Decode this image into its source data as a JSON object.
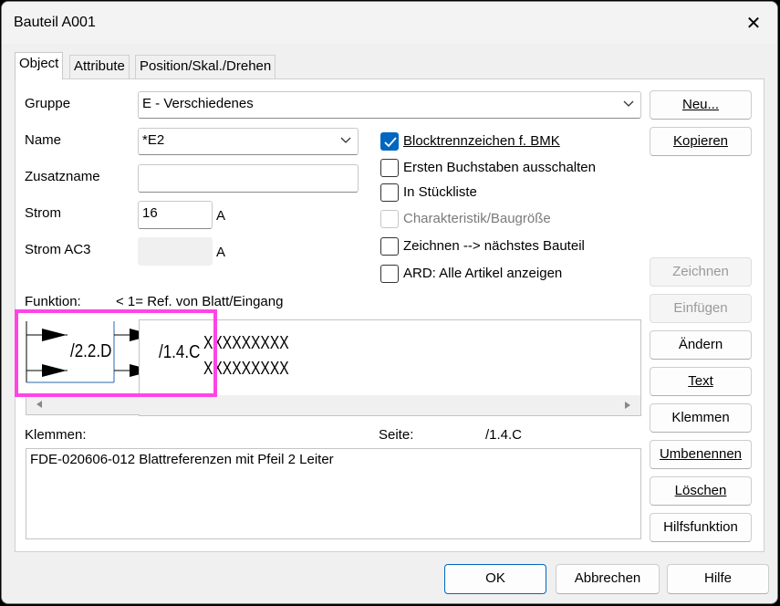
{
  "window": {
    "title": "Bauteil A001"
  },
  "tabs": [
    {
      "label": "Object",
      "active": true
    },
    {
      "label": "Attribute",
      "active": false
    },
    {
      "label": "Position/Skal./Drehen",
      "active": false
    }
  ],
  "form": {
    "gruppe_label": "Gruppe",
    "gruppe_value": "E - Verschiedenes",
    "name_label": "Name",
    "name_value": "*E2",
    "zusatzname_label": "Zusatzname",
    "zusatzname_value": "",
    "strom_label": "Strom",
    "strom_value": "16",
    "strom_unit": "A",
    "strom_ac3_label": "Strom AC3",
    "strom_ac3_value": "",
    "strom_ac3_unit": "A"
  },
  "checkboxes": [
    {
      "label": "Blocktrennzeichen f. BMK",
      "checked": true,
      "enabled": true
    },
    {
      "label": "Ersten Buchstaben ausschalten",
      "checked": false,
      "enabled": true
    },
    {
      "label": "In Stückliste",
      "checked": false,
      "enabled": true
    },
    {
      "label": "Charakteristik/Baugröße",
      "checked": false,
      "enabled": false
    },
    {
      "label": "Zeichnen --> nächstes Bauteil",
      "checked": false,
      "enabled": true
    },
    {
      "label": "ARD: Alle Artikel anzeigen",
      "checked": false,
      "enabled": true
    }
  ],
  "funktion": {
    "label": "Funktion:",
    "value": "< 1= Ref. von Blatt/Eingang",
    "ref_left": "/2.2.D",
    "ref_right": "/1.4.C",
    "text_line1": "XXXXXXXXX",
    "text_line2": "XXXXXXXXX"
  },
  "klemmen": {
    "label": "Klemmen:",
    "seite_label": "Seite:",
    "seite_value": "/1.4.C",
    "content": "FDE-020606-012  Blattreferenzen mit  Pfeil  2 Leiter"
  },
  "side_buttons": {
    "neu": "Neu...",
    "kopieren": "Kopieren",
    "zeichnen": "Zeichnen",
    "einfuegen": "Einfügen",
    "aendern": "Ändern",
    "text": "Text",
    "klemmen": "Klemmen",
    "umbenennen": "Umbenennen",
    "loeschen": "Löschen",
    "hilfsfunktion": "Hilfsfunktion"
  },
  "footer_buttons": {
    "ok": "OK",
    "abbrechen": "Abbrechen",
    "hilfe": "Hilfe"
  },
  "colors": {
    "accent": "#0067c0",
    "highlight": "#ff44e6"
  }
}
